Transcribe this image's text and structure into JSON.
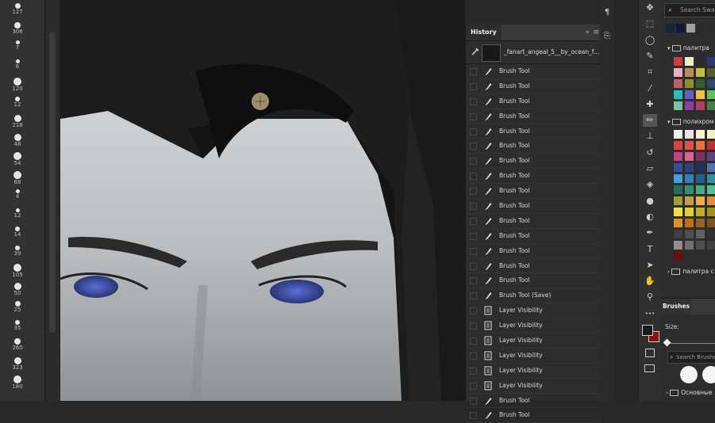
{
  "brush_presets": [
    {
      "size": "127",
      "icon": "spiky-brush-icon"
    },
    {
      "size": "306",
      "icon": "splatter-brush-icon"
    },
    {
      "size": "7",
      "icon": "small-brush-icon"
    },
    {
      "size": "6",
      "icon": "small-brush-icon"
    },
    {
      "size": "120",
      "icon": "soft-round-brush-icon"
    },
    {
      "size": "12",
      "icon": "small-brush-icon"
    },
    {
      "size": "218",
      "icon": "dot-brush-icon"
    },
    {
      "size": "48",
      "icon": "round-brush-icon"
    },
    {
      "size": "54",
      "icon": "texture-brush-icon"
    },
    {
      "size": "68",
      "icon": "texture-brush-icon"
    },
    {
      "size": "4",
      "icon": "stroke-brush-icon"
    },
    {
      "size": "12",
      "icon": "stroke-brush-icon"
    },
    {
      "size": "14",
      "icon": "stroke-brush-icon"
    },
    {
      "size": "39",
      "icon": "stroke-brush-icon"
    },
    {
      "size": "105",
      "icon": "round-brush-icon"
    },
    {
      "size": "50",
      "icon": "triangle-brush-icon"
    },
    {
      "size": "25",
      "icon": "flat-brush-icon"
    },
    {
      "size": "35",
      "icon": "stroke-brush-icon"
    },
    {
      "size": "260",
      "icon": "dot-brush-icon"
    },
    {
      "size": "323",
      "icon": "texture-brush-icon"
    },
    {
      "size": "180",
      "icon": "texture-brush-icon"
    }
  ],
  "history": {
    "tab_label": "History",
    "collapse_icon": "double-chevron-icon",
    "menu_icon": "hamburger-icon",
    "snapshot_name": "_fanart_angeal_5__by_ocean_f...",
    "states": [
      {
        "label": "Brush Tool",
        "icon": "brush-icon"
      },
      {
        "label": "Brush Tool",
        "icon": "brush-icon"
      },
      {
        "label": "Brush Tool",
        "icon": "brush-icon"
      },
      {
        "label": "Brush Tool",
        "icon": "brush-icon"
      },
      {
        "label": "Brush Tool",
        "icon": "brush-icon"
      },
      {
        "label": "Brush Tool",
        "icon": "brush-icon"
      },
      {
        "label": "Brush Tool",
        "icon": "brush-icon"
      },
      {
        "label": "Brush Tool",
        "icon": "brush-icon"
      },
      {
        "label": "Brush Tool",
        "icon": "brush-icon"
      },
      {
        "label": "Brush Tool",
        "icon": "brush-icon"
      },
      {
        "label": "Brush Tool",
        "icon": "brush-icon"
      },
      {
        "label": "Brush Tool",
        "icon": "brush-icon"
      },
      {
        "label": "Brush Tool",
        "icon": "brush-icon"
      },
      {
        "label": "Brush Tool",
        "icon": "brush-icon"
      },
      {
        "label": "Brush Tool",
        "icon": "brush-icon"
      },
      {
        "label": "Brush Tool (Save)",
        "icon": "brush-icon"
      },
      {
        "label": "Layer Visibility",
        "icon": "layer-doc-icon"
      },
      {
        "label": "Layer Visibility",
        "icon": "layer-doc-icon"
      },
      {
        "label": "Layer Visibility",
        "icon": "layer-doc-icon"
      },
      {
        "label": "Layer Visibility",
        "icon": "layer-doc-icon"
      },
      {
        "label": "Layer Visibility",
        "icon": "layer-doc-icon"
      },
      {
        "label": "Layer Visibility",
        "icon": "layer-doc-icon"
      },
      {
        "label": "Brush Tool",
        "icon": "brush-icon"
      },
      {
        "label": "Brush Tool",
        "icon": "brush-icon"
      }
    ]
  },
  "mini_toolbar": [
    "paragraph-icon",
    "brush-settings-icon"
  ],
  "tools": [
    "move-icon",
    "marquee-icon",
    "lasso-icon",
    "quick-select-icon",
    "crop-icon",
    "eyedropper-icon",
    "healing-icon",
    "brush-icon",
    "stamp-icon",
    "history-brush-icon",
    "eraser-icon",
    "paint-bucket-icon",
    "blur-icon",
    "dodge-icon",
    "pen-icon",
    "type-icon",
    "path-select-icon",
    "hand-icon",
    "zoom-icon",
    "more-icon"
  ],
  "colors": {
    "foreground": "#1a1a1a",
    "background": "#8a1010"
  },
  "swatches": {
    "search_placeholder": "Search Swatches",
    "recent": [
      "#1a2235",
      "#0c1a33",
      "#a0a0a0",
      "#2a2a2a",
      "#2a2a2a"
    ],
    "group1_name": "палитра",
    "group1": [
      "#cf3b3b",
      "#f0efc0",
      "#2a2a2a",
      "#2a3a70",
      "#e8b0c0",
      "#b89060",
      "#c0c040",
      "#506030",
      "#c06060",
      "#909020",
      "#306030",
      "#2c4a70",
      "#20c0c0",
      "#6060c0",
      "#f0c040",
      "#60c060",
      "#80c0a0",
      "#9040a0",
      "#b04060",
      "#408040"
    ],
    "group2_name": "полихром",
    "group2": [
      "#f0f0f0",
      "#f4e0e0",
      "#f8f0d0",
      "#f0f0c8",
      "#e04040",
      "#e05050",
      "#f07030",
      "#c03030",
      "#c04080",
      "#e06090",
      "#803060",
      "#604080",
      "#3050a0",
      "#304080",
      "#203060",
      "#5070b0",
      "#40a0e0",
      "#3080c0",
      "#206090",
      "#3090a0",
      "#207060",
      "#309070",
      "#40b080",
      "#50c090",
      "#a0a030",
      "#c0a040",
      "#f0b040",
      "#e09030",
      "#f0e040",
      "#e0d030",
      "#c0b020",
      "#a09020",
      "#e09020",
      "#c07010",
      "#a06020",
      "#805020",
      "#404040",
      "#505050",
      "#606060",
      "#303030",
      "#909090",
      "#707070",
      "#505050",
      "#404040",
      "#6a1010"
    ],
    "group3_name": "палитра с"
  },
  "brushes": {
    "tab_label": "Brushes",
    "size_label": "Size:",
    "size_value_fraction": 0.02,
    "search_placeholder": "Search Brushes",
    "group_name": "Основные"
  }
}
